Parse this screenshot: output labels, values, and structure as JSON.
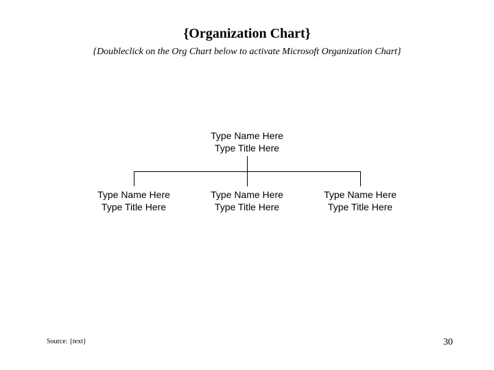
{
  "header": {
    "title": "{Organization Chart}",
    "subtitle": "{Doubleclick on the Org Chart below to activate Microsoft Organization Chart}"
  },
  "chart_data": {
    "type": "tree",
    "root": {
      "name": "Type Name Here",
      "title": "Type Title Here"
    },
    "children": [
      {
        "name": "Type Name Here",
        "title": "Type Title Here"
      },
      {
        "name": "Type Name Here",
        "title": "Type Title Here"
      },
      {
        "name": "Type Name Here",
        "title": "Type Title Here"
      }
    ]
  },
  "footer": {
    "source": "Source: {text}",
    "page_number": "30"
  }
}
